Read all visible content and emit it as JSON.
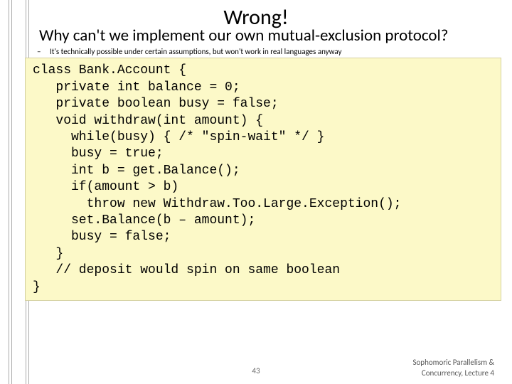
{
  "slide": {
    "overlay_title": "Wrong!",
    "subtitle": "Why can't we implement our own mutual-exclusion protocol?",
    "sub_bullet": "It's technically possible under certain assumptions, but won't work in real languages anyway",
    "code": "class Bank.Account {\n   private int balance = 0;\n   private boolean busy = false;\n   void withdraw(int amount) {\n     while(busy) { /* \"spin-wait\" */ }\n     busy = true;\n     int b = get.Balance();\n     if(amount > b)\n       throw new Withdraw.Too.Large.Exception();\n     set.Balance(b – amount);\n     busy = false;\n   }\n   // deposit would spin on same boolean\n}",
    "page_number": "43",
    "footer_line1": "Sophomoric Parallelism &",
    "footer_line2": "Concurrency, Lecture 4"
  }
}
